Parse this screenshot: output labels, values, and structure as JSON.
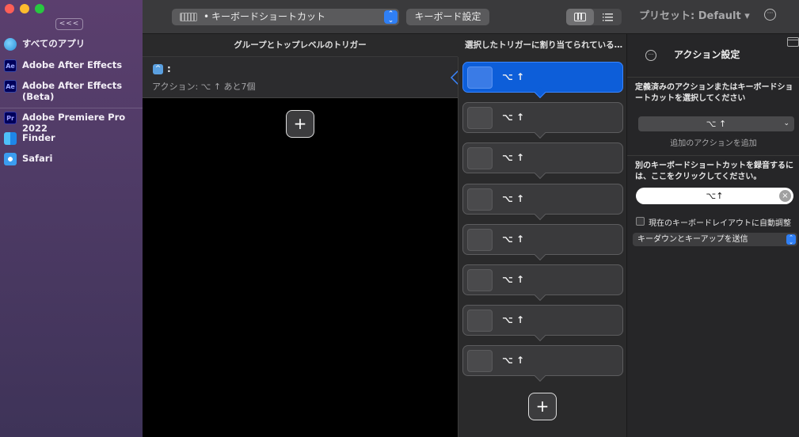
{
  "sidebar": {
    "collapse_label": "<<<",
    "apps": [
      {
        "label": "すべてのアプリ",
        "icon": "globe-icon",
        "badge": ""
      },
      {
        "label": "Adobe After Effects",
        "icon": "after-effects-icon",
        "badge": "Ae"
      },
      {
        "label": "Adobe After Effects\n(Beta)",
        "icon": "after-effects-beta-icon",
        "badge": "Ae"
      },
      {
        "label": "Adobe Premiere Pro 2022",
        "icon": "premiere-pro-icon",
        "badge": "Pr"
      },
      {
        "label": "Finder",
        "icon": "finder-icon",
        "badge": ""
      },
      {
        "label": "Safari",
        "icon": "safari-icon",
        "badge": ""
      }
    ]
  },
  "toolbar": {
    "trigger_select_label": "キーボードショートカット",
    "keyboard_settings_label": "キーボード設定",
    "preset_label": "プリセット: Default ▾",
    "more_label": "···"
  },
  "groups": {
    "header": "グループとトップレベルのトリガー",
    "row_title": ":",
    "row_icon": "^",
    "row_desc": "アクション: ⌥ ↑ あと7個",
    "add_label": "+"
  },
  "actions": {
    "header": "選択したトリガーに割り当てられている…",
    "items": [
      {
        "label": "⌥ ↑",
        "selected": true
      },
      {
        "label": "⌥ ↑",
        "selected": false
      },
      {
        "label": "⌥ ↑",
        "selected": false
      },
      {
        "label": "⌥ ↑",
        "selected": false
      },
      {
        "label": "⌥ ↑",
        "selected": false
      },
      {
        "label": "⌥ ↑",
        "selected": false
      },
      {
        "label": "⌥ ↑",
        "selected": false
      },
      {
        "label": "⌥ ↑",
        "selected": false
      }
    ],
    "add_label": "+"
  },
  "settings": {
    "title": "アクション設定",
    "more_label": "···",
    "choose_label": "定義済みのアクションまたはキーボードショートカットを選択してください",
    "action_value": "⌥ ↑",
    "add_action_link": "追加のアクションを追加",
    "record_label": "別のキーボードショートカットを録音するには、ここをクリックしてください。",
    "record_value": "⌥↑",
    "auto_adjust_label": "現在のキーボードレイアウトに自動調整",
    "send_option": "キーダウンとキーアップを送信"
  },
  "colors": {
    "accent": "#0d5ed9",
    "sidebar_top": "#5b3f6e",
    "close": "#fe5f57",
    "minimize": "#febc2e",
    "zoom": "#28c840"
  }
}
